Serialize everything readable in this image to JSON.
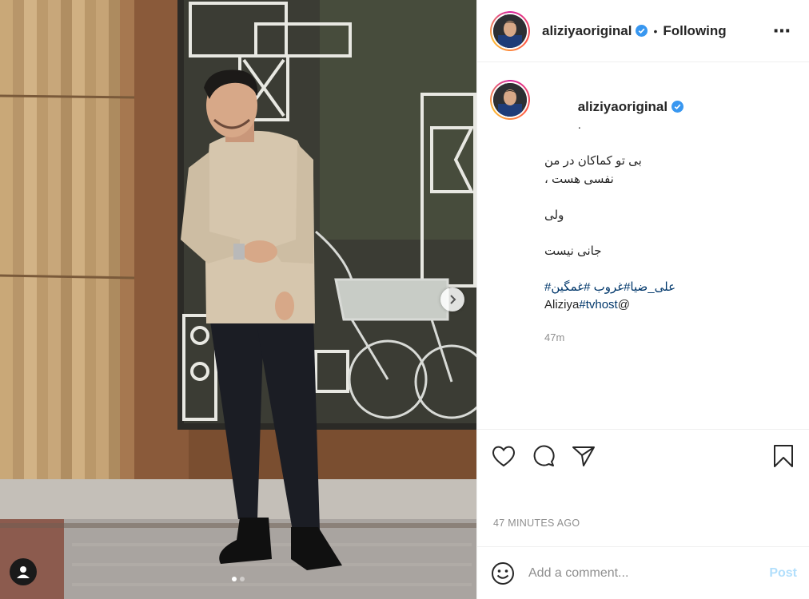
{
  "post": {
    "username": "aliziyaoriginal",
    "verified": true,
    "follow_separator": "•",
    "follow_status": "Following",
    "more_icon": "⋯",
    "image_dots": 2,
    "image_active_index": 0
  },
  "caption": {
    "username": "aliziyaoriginal",
    "lines": [
      ".",
      "بی تو کماکان در من",
      "، نفسی هست",
      "",
      "ولی",
      "",
      "جانی نیست"
    ],
    "hashtags_line": "#علی_ضیا#غروب #غمگین",
    "handle_text": "Aliziya",
    "handle_tag": "#tvhost",
    "handle_suffix": "@",
    "relative_time": "47m"
  },
  "actions": {
    "like_icon": "heart-icon",
    "comment_icon": "comment-icon",
    "share_icon": "paper-plane-icon",
    "save_icon": "bookmark-icon"
  },
  "posted_time": "47 MINUTES AGO",
  "comment_box": {
    "placeholder": "Add a comment...",
    "post_label": "Post"
  },
  "colors": {
    "link": "#00376b",
    "muted": "#8e8e8e",
    "verified": "#3897f0",
    "post_disabled": "#b2dffc"
  }
}
